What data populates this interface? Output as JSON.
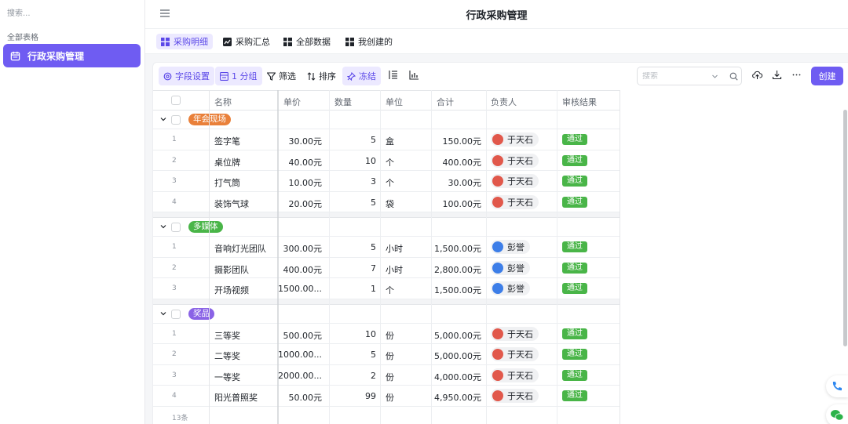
{
  "sidebar": {
    "search_placeholder": "搜索...",
    "section_label": "全部表格",
    "items": [
      {
        "label": "行政采购管理",
        "icon": "calendar-icon"
      }
    ]
  },
  "header": {
    "title": "行政采购管理"
  },
  "tabs": [
    {
      "label": "采购明细",
      "icon": "grid-table-icon",
      "active": true
    },
    {
      "label": "采购汇总",
      "icon": "chart-box-icon",
      "active": false
    },
    {
      "label": "全部数据",
      "icon": "grid-table-icon",
      "active": false
    },
    {
      "label": "我创建的",
      "icon": "grid-table-icon",
      "active": false
    }
  ],
  "toolbar": {
    "field_settings": "字段设置",
    "group": "1 分组",
    "filter": "筛选",
    "sort": "排序",
    "freeze": "冻结",
    "search_placeholder": "搜索",
    "create": "创建"
  },
  "columns": [
    "名称",
    "单价",
    "数量",
    "单位",
    "合计",
    "负责人",
    "审核结果"
  ],
  "groups": [
    {
      "tag": "年会现场",
      "color": "#e9803a",
      "rows": [
        {
          "idx": "1",
          "name": "签字笔",
          "price": "30.00元",
          "qty": "5",
          "unit": "盒",
          "total": "150.00元",
          "owner": "于天石",
          "result": "通过"
        },
        {
          "idx": "2",
          "name": "桌位牌",
          "price": "40.00元",
          "qty": "10",
          "unit": "个",
          "total": "400.00元",
          "owner": "于天石",
          "result": "通过"
        },
        {
          "idx": "3",
          "name": "打气筒",
          "price": "10.00元",
          "qty": "3",
          "unit": "个",
          "total": "30.00元",
          "owner": "于天石",
          "result": "通过"
        },
        {
          "idx": "4",
          "name": "装饰气球",
          "price": "20.00元",
          "qty": "5",
          "unit": "袋",
          "total": "100.00元",
          "owner": "于天石",
          "result": "通过"
        }
      ]
    },
    {
      "tag": "多媒体",
      "color": "#49b548",
      "rows": [
        {
          "idx": "1",
          "name": "音响灯光团队",
          "price": "300.00元",
          "qty": "5",
          "unit": "小时",
          "total": "1,500.00元",
          "owner": "彭誉",
          "result": "通过"
        },
        {
          "idx": "2",
          "name": "摄影团队",
          "price": "400.00元",
          "qty": "7",
          "unit": "小时",
          "total": "2,800.00元",
          "owner": "彭誉",
          "result": "通过"
        },
        {
          "idx": "3",
          "name": "开场视频",
          "price": "1500.00...",
          "qty": "1",
          "unit": "个",
          "total": "1,500.00元",
          "owner": "彭誉",
          "result": "通过"
        }
      ]
    },
    {
      "tag": "奖品",
      "color": "#8a63e6",
      "rows": [
        {
          "idx": "1",
          "name": "三等奖",
          "price": "500.00元",
          "qty": "10",
          "unit": "份",
          "total": "5,000.00元",
          "owner": "于天石",
          "result": "通过"
        },
        {
          "idx": "2",
          "name": "二等奖",
          "price": "1000.00...",
          "qty": "5",
          "unit": "份",
          "total": "5,000.00元",
          "owner": "于天石",
          "result": "通过"
        },
        {
          "idx": "3",
          "name": "一等奖",
          "price": "2000.00...",
          "qty": "2",
          "unit": "份",
          "total": "4,000.00元",
          "owner": "于天石",
          "result": "通过"
        },
        {
          "idx": "4",
          "name": "阳光普照奖",
          "price": "50.00元",
          "qty": "99",
          "unit": "份",
          "total": "4,950.00元",
          "owner": "于天石",
          "result": "通过"
        }
      ]
    }
  ],
  "footer": {
    "count": "13条"
  },
  "colors": {
    "accent": "#6f5cf2",
    "accent_light": "#ece9ff",
    "pass_green": "#49b548"
  }
}
